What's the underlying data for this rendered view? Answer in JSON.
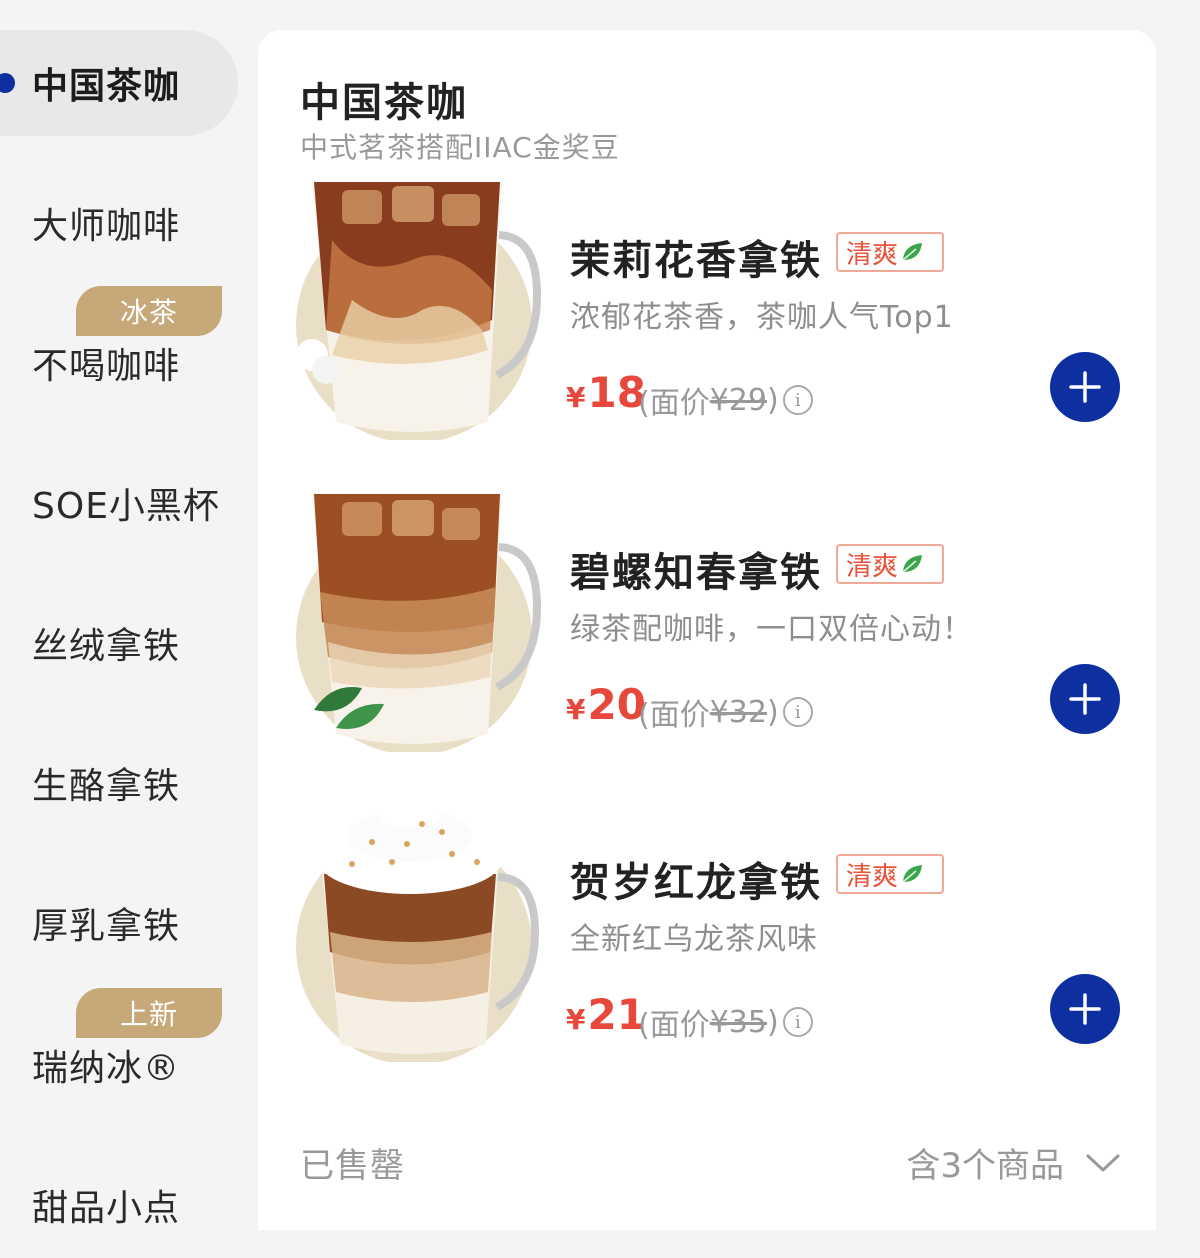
{
  "sidebar": {
    "items": [
      {
        "label": "中国茶咖",
        "active": true
      },
      {
        "label": "大师咖啡"
      },
      {
        "label": "不喝咖啡",
        "badge": "冰茶"
      },
      {
        "label": "SOE小黑杯"
      },
      {
        "label": "丝绒拿铁"
      },
      {
        "label": "生酪拿铁"
      },
      {
        "label": "厚乳拿铁"
      },
      {
        "label": "瑞纳冰®",
        "badge": "上新"
      },
      {
        "label": "甜品小点"
      }
    ]
  },
  "category": {
    "title": "中国茶咖",
    "subtitle": "中式茗茶搭配IIAC金奖豆"
  },
  "products": [
    {
      "name": "茉莉花香拿铁",
      "tag": "清爽",
      "description": "浓郁花茶香，茶咖人气Top1",
      "currency": "¥",
      "price": "18",
      "orig_prefix": "(面价",
      "orig_price": "¥29",
      "orig_suffix": ")",
      "image": "jasmine-latte-image"
    },
    {
      "name": "碧螺知春拿铁",
      "tag": "清爽",
      "description": "绿茶配咖啡，一口双倍心动！",
      "currency": "¥",
      "price": "20",
      "orig_prefix": "(面价",
      "orig_price": "¥32",
      "orig_suffix": ")",
      "image": "biluochun-latte-image"
    },
    {
      "name": "贺岁红龙拿铁",
      "tag": "清爽",
      "description": "全新红乌龙茶风味",
      "currency": "¥",
      "price": "21",
      "orig_prefix": "(面价",
      "orig_price": "¥35",
      "orig_suffix": ")",
      "image": "red-oolong-latte-image"
    }
  ],
  "footer": {
    "sold_out": "已售罄",
    "count": "含3个商品"
  },
  "colors": {
    "accent": "#0d2fa0",
    "price": "#e8473b",
    "badge": "#c7a878",
    "tag": "#e8543a"
  }
}
